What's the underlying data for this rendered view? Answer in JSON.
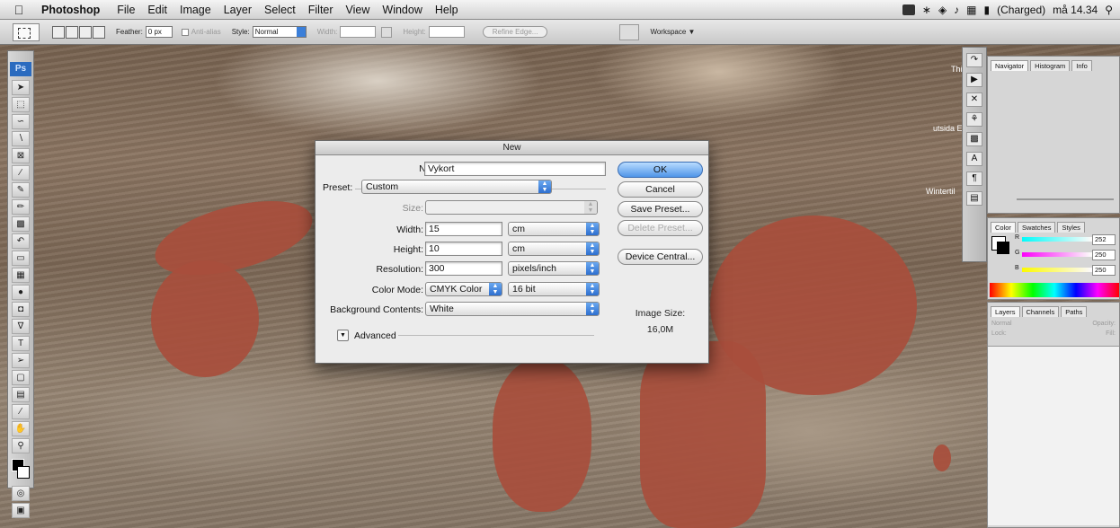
{
  "menubar": {
    "app": "Photoshop",
    "items": [
      "File",
      "Edit",
      "Image",
      "Layer",
      "Select",
      "Filter",
      "View",
      "Window",
      "Help"
    ],
    "battery": "(Charged)",
    "clock": "må 14.34"
  },
  "options": {
    "feather_label": "Feather:",
    "feather_value": "0 px",
    "antialias": "Anti-alias",
    "style_label": "Style:",
    "style_value": "Normal",
    "width_label": "Width:",
    "height_label": "Height:",
    "refine": "Refine Edge...",
    "workspace": "Workspace ▼"
  },
  "toolbox": {
    "logo": "Ps"
  },
  "canvas_labels": {
    "a": "Thi",
    "b": "utsida E",
    "c": "Wintertil"
  },
  "panels": {
    "nav_tabs": [
      "Navigator",
      "Histogram",
      "Info"
    ],
    "color_tabs": [
      "Color",
      "Swatches",
      "Styles"
    ],
    "color": {
      "r_label": "R",
      "g_label": "G",
      "b_label": "B",
      "r": "252",
      "g": "250",
      "b": "250"
    },
    "layer_tabs": [
      "Layers",
      "Channels",
      "Paths"
    ],
    "blend": "Normal",
    "opacity_label": "Opacity:",
    "lock_label": "Lock:",
    "fill_label": "Fill:"
  },
  "dialog": {
    "title": "New",
    "name_label": "Name:",
    "name_value": "Vykort",
    "preset_label": "Preset:",
    "preset_value": "Custom",
    "size_label": "Size:",
    "width_label": "Width:",
    "width_value": "15",
    "width_unit": "cm",
    "height_label": "Height:",
    "height_value": "10",
    "height_unit": "cm",
    "res_label": "Resolution:",
    "res_value": "300",
    "res_unit": "pixels/inch",
    "mode_label": "Color Mode:",
    "mode_value": "CMYK Color",
    "depth_value": "16 bit",
    "bg_label": "Background Contents:",
    "bg_value": "White",
    "advanced": "Advanced",
    "ok": "OK",
    "cancel": "Cancel",
    "save_preset": "Save Preset...",
    "delete_preset": "Delete Preset...",
    "device_central": "Device Central...",
    "image_size_label": "Image Size:",
    "image_size_value": "16,0M"
  }
}
